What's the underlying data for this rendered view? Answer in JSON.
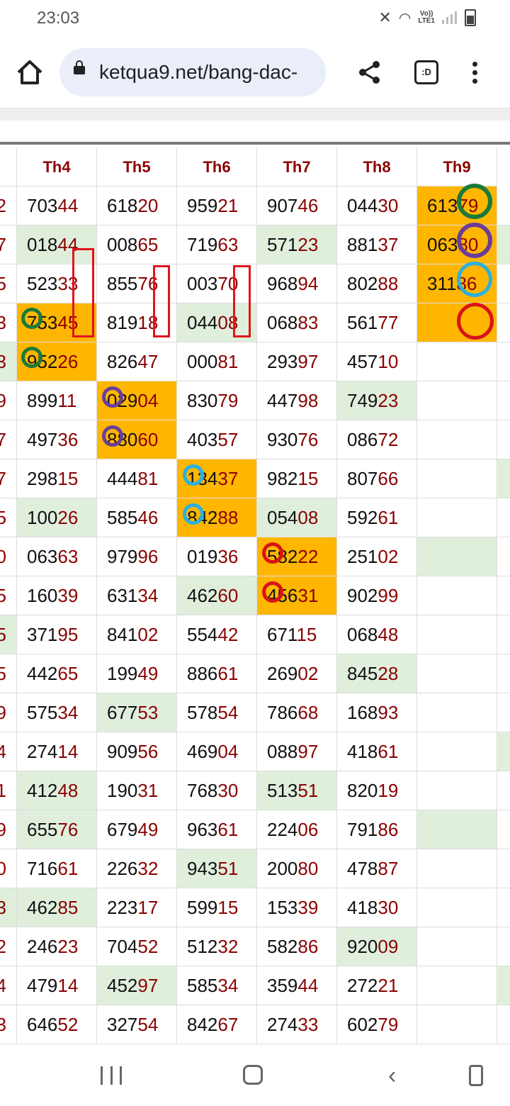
{
  "status_bar": {
    "time": "23:03",
    "lte_top": "Vo))",
    "lte_bottom": "LTE1"
  },
  "browser": {
    "url": "ketqua9.net/bang-dac-",
    "tabs_label": ":D"
  },
  "table": {
    "edge_values": [
      "2",
      "7",
      "5",
      "3",
      "3",
      "9",
      "7",
      "7",
      "5",
      "0",
      "5",
      "5",
      "5",
      "9",
      "4",
      "1",
      "9",
      "0",
      "3",
      "2",
      "4",
      "3"
    ],
    "columns": [
      {
        "header": "Th4",
        "cells": [
          [
            "703",
            "44"
          ],
          [
            "018",
            "44"
          ],
          [
            "523",
            "33"
          ],
          [
            "753",
            "45"
          ],
          [
            "952",
            "26"
          ],
          [
            "899",
            "11"
          ],
          [
            "497",
            "36"
          ],
          [
            "298",
            "15"
          ],
          [
            "100",
            "26"
          ],
          [
            "063",
            "63"
          ],
          [
            "160",
            "39"
          ],
          [
            "371",
            "95"
          ],
          [
            "442",
            "65"
          ],
          [
            "575",
            "34"
          ],
          [
            "274",
            "14"
          ],
          [
            "412",
            "48"
          ],
          [
            "655",
            "76"
          ],
          [
            "716",
            "61"
          ],
          [
            "462",
            "85"
          ],
          [
            "246",
            "23"
          ],
          [
            "479",
            "14"
          ],
          [
            "646",
            "52"
          ]
        ]
      },
      {
        "header": "Th5",
        "cells": [
          [
            "618",
            "20"
          ],
          [
            "008",
            "65"
          ],
          [
            "855",
            "76"
          ],
          [
            "819",
            "18"
          ],
          [
            "826",
            "47"
          ],
          [
            "029",
            "04"
          ],
          [
            "880",
            "60"
          ],
          [
            "444",
            "81"
          ],
          [
            "585",
            "46"
          ],
          [
            "979",
            "96"
          ],
          [
            "631",
            "34"
          ],
          [
            "841",
            "02"
          ],
          [
            "199",
            "49"
          ],
          [
            "677",
            "53"
          ],
          [
            "909",
            "56"
          ],
          [
            "190",
            "31"
          ],
          [
            "679",
            "49"
          ],
          [
            "226",
            "32"
          ],
          [
            "223",
            "17"
          ],
          [
            "704",
            "52"
          ],
          [
            "452",
            "97"
          ],
          [
            "327",
            "54"
          ]
        ]
      },
      {
        "header": "Th6",
        "cells": [
          [
            "959",
            "21"
          ],
          [
            "719",
            "63"
          ],
          [
            "003",
            "70"
          ],
          [
            "044",
            "08"
          ],
          [
            "000",
            "81"
          ],
          [
            "830",
            "79"
          ],
          [
            "403",
            "57"
          ],
          [
            "134",
            "37"
          ],
          [
            "842",
            "88"
          ],
          [
            "019",
            "36"
          ],
          [
            "462",
            "60"
          ],
          [
            "554",
            "42"
          ],
          [
            "886",
            "61"
          ],
          [
            "578",
            "54"
          ],
          [
            "469",
            "04"
          ],
          [
            "768",
            "30"
          ],
          [
            "963",
            "61"
          ],
          [
            "943",
            "51"
          ],
          [
            "599",
            "15"
          ],
          [
            "512",
            "32"
          ],
          [
            "585",
            "34"
          ],
          [
            "842",
            "67"
          ]
        ]
      },
      {
        "header": "Th7",
        "cells": [
          [
            "907",
            "46"
          ],
          [
            "571",
            "23"
          ],
          [
            "968",
            "94"
          ],
          [
            "068",
            "83"
          ],
          [
            "293",
            "97"
          ],
          [
            "447",
            "98"
          ],
          [
            "930",
            "76"
          ],
          [
            "982",
            "15"
          ],
          [
            "054",
            "08"
          ],
          [
            "582",
            "22"
          ],
          [
            "456",
            "31"
          ],
          [
            "671",
            "15"
          ],
          [
            "269",
            "02"
          ],
          [
            "786",
            "68"
          ],
          [
            "088",
            "97"
          ],
          [
            "513",
            "51"
          ],
          [
            "224",
            "06"
          ],
          [
            "200",
            "80"
          ],
          [
            "153",
            "39"
          ],
          [
            "582",
            "86"
          ],
          [
            "359",
            "44"
          ],
          [
            "274",
            "33"
          ]
        ]
      },
      {
        "header": "Th8",
        "cells": [
          [
            "044",
            "30"
          ],
          [
            "881",
            "37"
          ],
          [
            "802",
            "88"
          ],
          [
            "561",
            "77"
          ],
          [
            "457",
            "10"
          ],
          [
            "749",
            "23"
          ],
          [
            "086",
            "72"
          ],
          [
            "807",
            "66"
          ],
          [
            "592",
            "61"
          ],
          [
            "251",
            "02"
          ],
          [
            "902",
            "99"
          ],
          [
            "068",
            "48"
          ],
          [
            "845",
            "28"
          ],
          [
            "168",
            "93"
          ],
          [
            "418",
            "61"
          ],
          [
            "820",
            "19"
          ],
          [
            "791",
            "86"
          ],
          [
            "478",
            "87"
          ],
          [
            "418",
            "30"
          ],
          [
            "920",
            "09"
          ],
          [
            "272",
            "21"
          ],
          [
            "602",
            "79"
          ]
        ]
      },
      {
        "header": "Th9",
        "cells": [
          [
            "613",
            "79"
          ],
          [
            "063",
            "80"
          ],
          [
            "311",
            "86"
          ],
          [
            "",
            ""
          ]
        ]
      }
    ]
  }
}
